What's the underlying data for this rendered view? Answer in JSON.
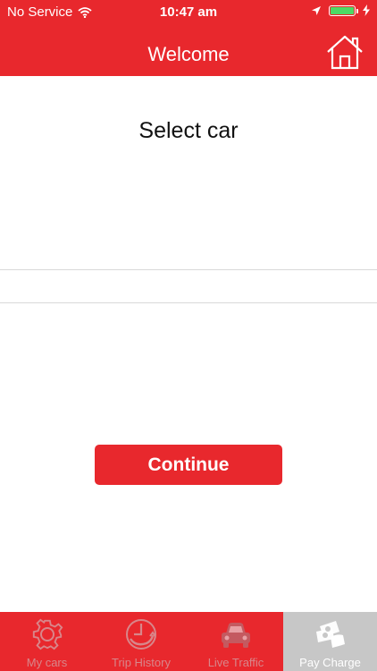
{
  "status_bar": {
    "carrier": "No Service",
    "time": "10:47 am",
    "icons": [
      "wifi-icon",
      "location-arrow-icon",
      "battery-icon",
      "charging-bolt-icon"
    ]
  },
  "nav": {
    "title": "Welcome",
    "home_icon": "home-icon"
  },
  "main": {
    "title": "Select car",
    "continue_label": "Continue"
  },
  "tabs": [
    {
      "label": "My cars",
      "icon": "gear-icon",
      "active": false
    },
    {
      "label": "Trip History",
      "icon": "clock-history-icon",
      "active": false
    },
    {
      "label": "Live Traffic",
      "icon": "car-icon",
      "active": false
    },
    {
      "label": "Pay Charge",
      "icon": "money-hand-icon",
      "active": true
    }
  ],
  "colors": {
    "brand_red": "#e8282d",
    "tab_inactive_text": "#d8868a",
    "tab_active_bg": "#c7c7c7",
    "battery_green": "#4cd964"
  }
}
